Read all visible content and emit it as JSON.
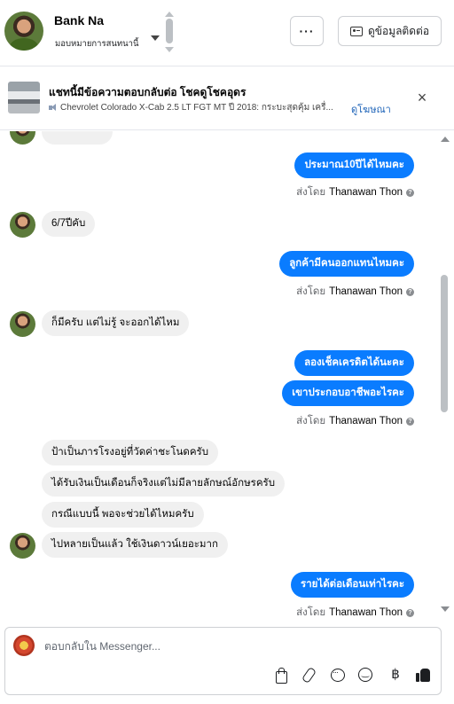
{
  "header": {
    "contact_name": "Bank Na",
    "assign_label": "มอบหมายการสนทนานี้",
    "more_label": "···",
    "contact_info_label": "ดูข้อมูลติดต่อ"
  },
  "ad": {
    "title": "แชทนี้มีข้อความตอบกลับต่อ โชคดูโชคอุดร",
    "description": "Chevrolet Colorado X-Cab 2.5 LT FGT MT ปี 2018: กระบะสุดคุ้ม เครื่...",
    "link_label": "ดูโฆษณา",
    "close_label": "×"
  },
  "messages": [
    {
      "from": "agent",
      "text": "ประมาณ10ปีได้ไหมคะ"
    },
    {
      "sent_by_prefix": "ส่งโดย",
      "sent_by_name": "Thanawan Thon"
    },
    {
      "from": "customer",
      "text": "6/7ปีคับ"
    },
    {
      "from": "agent",
      "text": "ลูกค้ามีคนออกแทนไหมคะ"
    },
    {
      "sent_by_prefix": "ส่งโดย",
      "sent_by_name": "Thanawan Thon"
    },
    {
      "from": "customer",
      "text": "ก็มีครับ แต่ไม่รู้ จะออกได้ไหม"
    },
    {
      "from": "agent",
      "text": "ลองเช็คเครดิตได้นะคะ"
    },
    {
      "from": "agent",
      "text": "เขาประกอบอาชีพอะไรคะ"
    },
    {
      "sent_by_prefix": "ส่งโดย",
      "sent_by_name": "Thanawan Thon"
    },
    {
      "from": "customer",
      "text": "ป้าเป็นภารโรงอยู่ที่วัดค่าชะโนดครับ"
    },
    {
      "from": "customer",
      "text": "ได้รับเงินเป็นเดือนก็จริงแต่ไม่มีลายลักษณ์อักษรครับ"
    },
    {
      "from": "customer",
      "text": "กรณีแบบนี้ พอจะช่วยได้ไหมครับ"
    },
    {
      "from": "customer",
      "text": "ไปหลายเป็นแล้ว ใช้เงินดาวน์เยอะมาก"
    },
    {
      "from": "agent",
      "text": "รายได้ต่อเดือนเท่าไรคะ"
    },
    {
      "sent_by_prefix": "ส่งโดย",
      "sent_by_name": "Thanawan Thon"
    }
  ],
  "composer": {
    "placeholder": "ตอบกลับใน Messenger...",
    "baht_symbol": "฿"
  },
  "colors": {
    "outgoing_bubble": "#0a7cff",
    "incoming_bubble": "#f0f0f0",
    "link": "#1d63b8"
  },
  "icons": [
    "more-icon",
    "contact-card-icon",
    "speaker-icon",
    "close-icon",
    "info-icon",
    "shopping-bag-icon",
    "paperclip-icon",
    "chat-bubble-icon",
    "smiley-icon",
    "baht-icon",
    "thumbs-up-icon"
  ]
}
